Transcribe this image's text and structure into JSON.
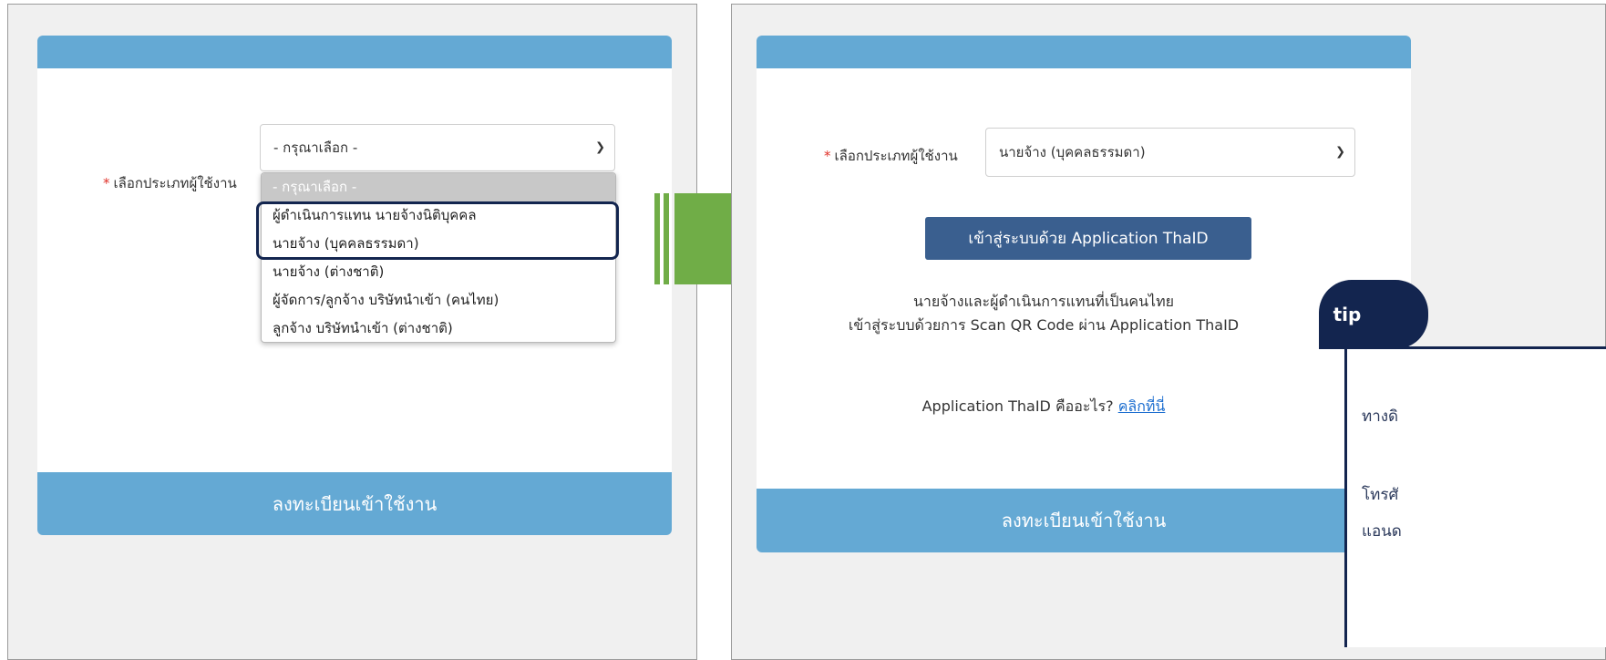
{
  "left": {
    "field_label": "เลือกประเภทผู้ใช้งาน",
    "select_value": "- กรุณาเลือก -",
    "options": [
      "- กรุณาเลือก -",
      "ผู้ดำเนินการแทน นายจ้างนิติบุคคล",
      "นายจ้าง (บุคคลธรรมดา)",
      "นายจ้าง (ต่างชาติ)",
      "ผู้จัดการ/ลูกจ้าง บริษัทนำเข้า (คนไทย)",
      "ลูกจ้าง บริษัทนำเข้า (ต่างชาติ)"
    ],
    "footer_label": "ลงทะเบียนเข้าใช้งาน"
  },
  "right": {
    "field_label": "เลือกประเภทผู้ใช้งาน",
    "select_value": "นายจ้าง (บุคคลธรรมดา)",
    "thaid_button": "เข้าสู่ระบบด้วย Application ThaID",
    "desc_line1": "นายจ้างและผู้ดำเนินการแทนที่เป็นคนไทย",
    "desc_line2": "เข้าสู่ระบบด้วยการ Scan QR Code ผ่าน Application ThaID",
    "what_is": "Application ThaID คืออะไร?",
    "click_here": "คลิกที่นี่",
    "footer_label": "ลงทะเบียนเข้าใช้งาน"
  },
  "tip": {
    "label": "tip",
    "line1": "ทางดิ",
    "line2": "โทรศั",
    "line3": "แอนด"
  },
  "colors": {
    "header_blue": "#64a9d4",
    "arrow_green": "#70ad47",
    "tip_navy": "#13254f",
    "button_blue": "#3a5f8f"
  },
  "required_marker": "*",
  "chevron_icon": "chevron-down-icon"
}
